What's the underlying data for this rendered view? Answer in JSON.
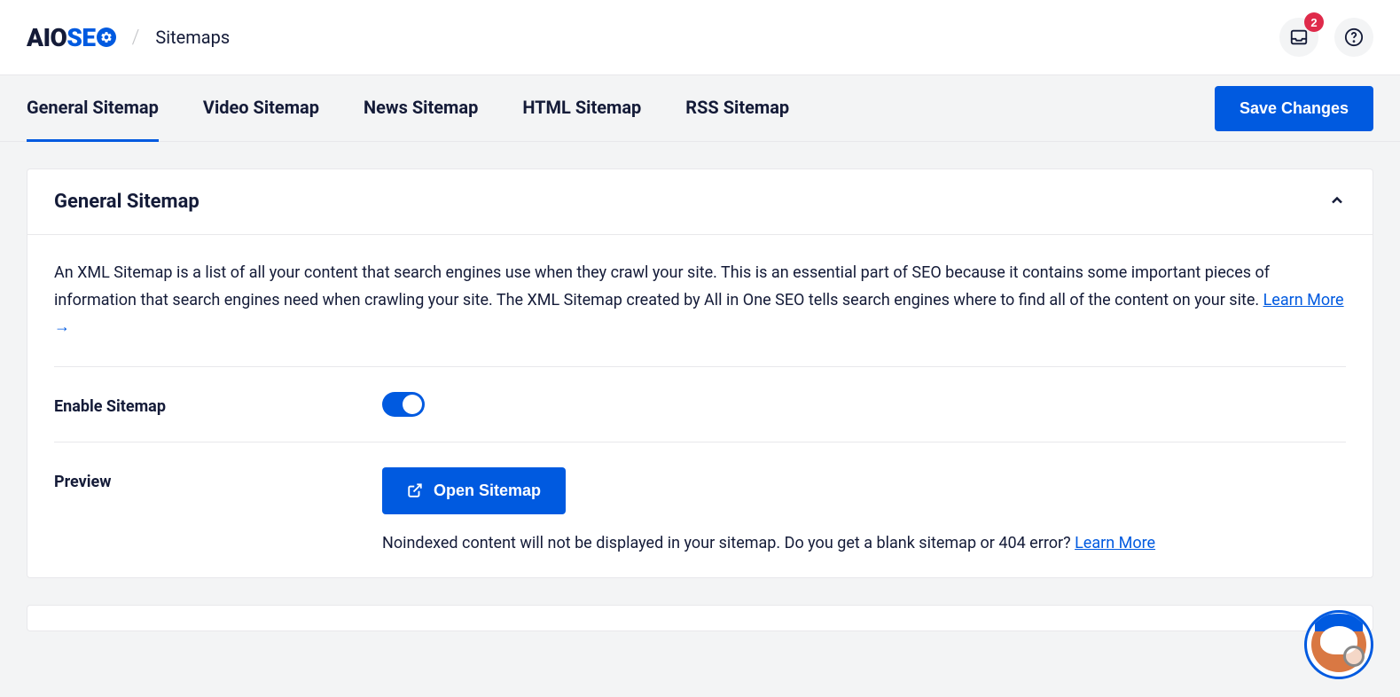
{
  "header": {
    "logo_aio": "AIO",
    "logo_se": "SE",
    "breadcrumb": "Sitemaps",
    "notification_count": "2"
  },
  "tabs": {
    "items": [
      {
        "label": "General Sitemap",
        "active": true
      },
      {
        "label": "Video Sitemap",
        "active": false
      },
      {
        "label": "News Sitemap",
        "active": false
      },
      {
        "label": "HTML Sitemap",
        "active": false
      },
      {
        "label": "RSS Sitemap",
        "active": false
      }
    ],
    "save_label": "Save Changes"
  },
  "card": {
    "title": "General Sitemap",
    "description": "An XML Sitemap is a list of all your content that search engines use when they crawl your site. This is an essential part of SEO because it contains some important pieces of information that search engines need when crawling your site. The XML Sitemap created by All in One SEO tells search engines where to find all of the content on your site. ",
    "learn_more": "Learn More",
    "arrow": " →",
    "enable_label": "Enable Sitemap",
    "preview_label": "Preview",
    "open_sitemap": "Open Sitemap",
    "help_text": "Noindexed content will not be displayed in your sitemap. Do you get a blank sitemap or 404 error? ",
    "help_learn_more": "Learn More"
  }
}
